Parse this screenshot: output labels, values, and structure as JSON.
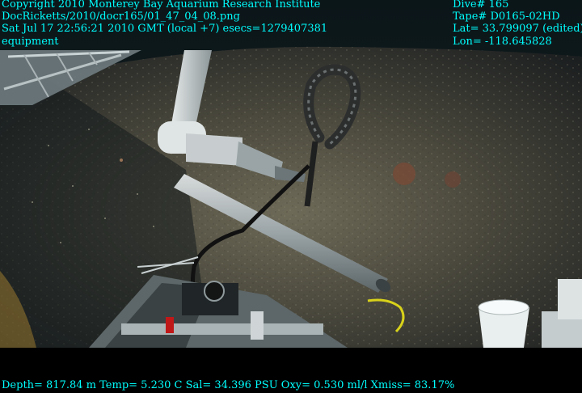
{
  "overlay": {
    "top_left": [
      "Copyright 2010 Monterey Bay Aquarium Research Institute",
      "DocRicketts/2010/docr165/01_47_04_08.png",
      "Sat Jul 17 22:56:21 2010 GMT (local +7)  esecs=1279407381",
      "equipment"
    ],
    "top_right": [
      "Dive# 165",
      "Tape# D0165-02HD",
      "Lat= 33.799097 (edited)",
      "Lon= -118.645828"
    ],
    "bottom": "Depth= 817.84 m  Temp= 5.230 C  Sal= 34.396 PSU  Oxy= 0.530 ml/l  Xmiss= 83.17%"
  },
  "colors": {
    "overlay_text": "#00ffff",
    "seafloor": "#4a4a3a",
    "water": "#0a1418"
  }
}
